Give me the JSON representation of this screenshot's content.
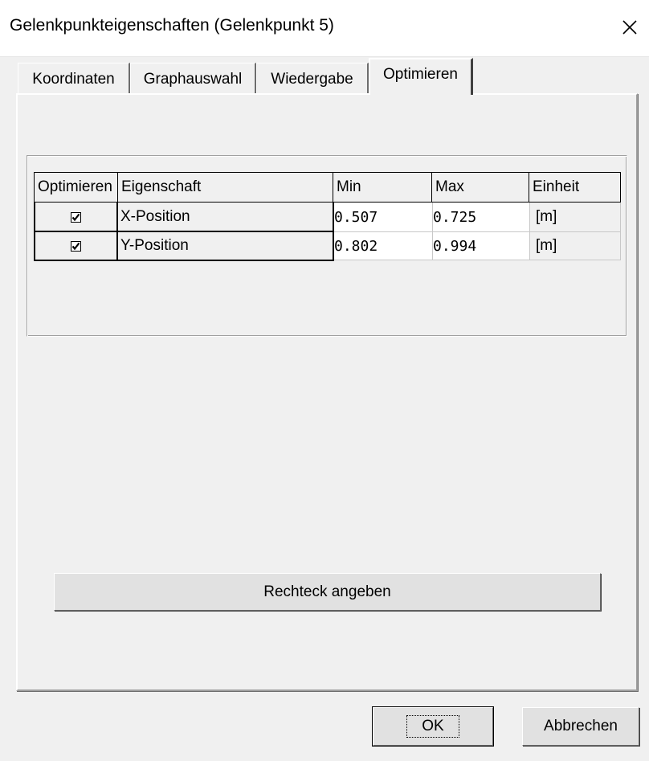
{
  "window": {
    "title": "Gelenkpunkteigenschaften (Gelenkpunkt 5)"
  },
  "tabs": [
    {
      "label": "Koordinaten"
    },
    {
      "label": "Graphauswahl"
    },
    {
      "label": "Wiedergabe"
    },
    {
      "label": "Optimieren"
    }
  ],
  "active_tab": "Optimieren",
  "grid": {
    "headers": {
      "optimize": "Optimieren",
      "property": "Eigenschaft",
      "min": "Min",
      "max": "Max",
      "unit": "Einheit"
    },
    "rows": [
      {
        "checked": true,
        "property": "X-Position",
        "min": "0.507",
        "max": "0.725",
        "unit": "[m]"
      },
      {
        "checked": true,
        "property": "Y-Position",
        "min": "0.802",
        "max": "0.994",
        "unit": "[m]"
      }
    ]
  },
  "buttons": {
    "rect": "Rechteck angeben",
    "ok": "OK",
    "cancel": "Abbrechen"
  },
  "icons": {
    "close": "close-icon",
    "check": "checkmark-icon"
  }
}
